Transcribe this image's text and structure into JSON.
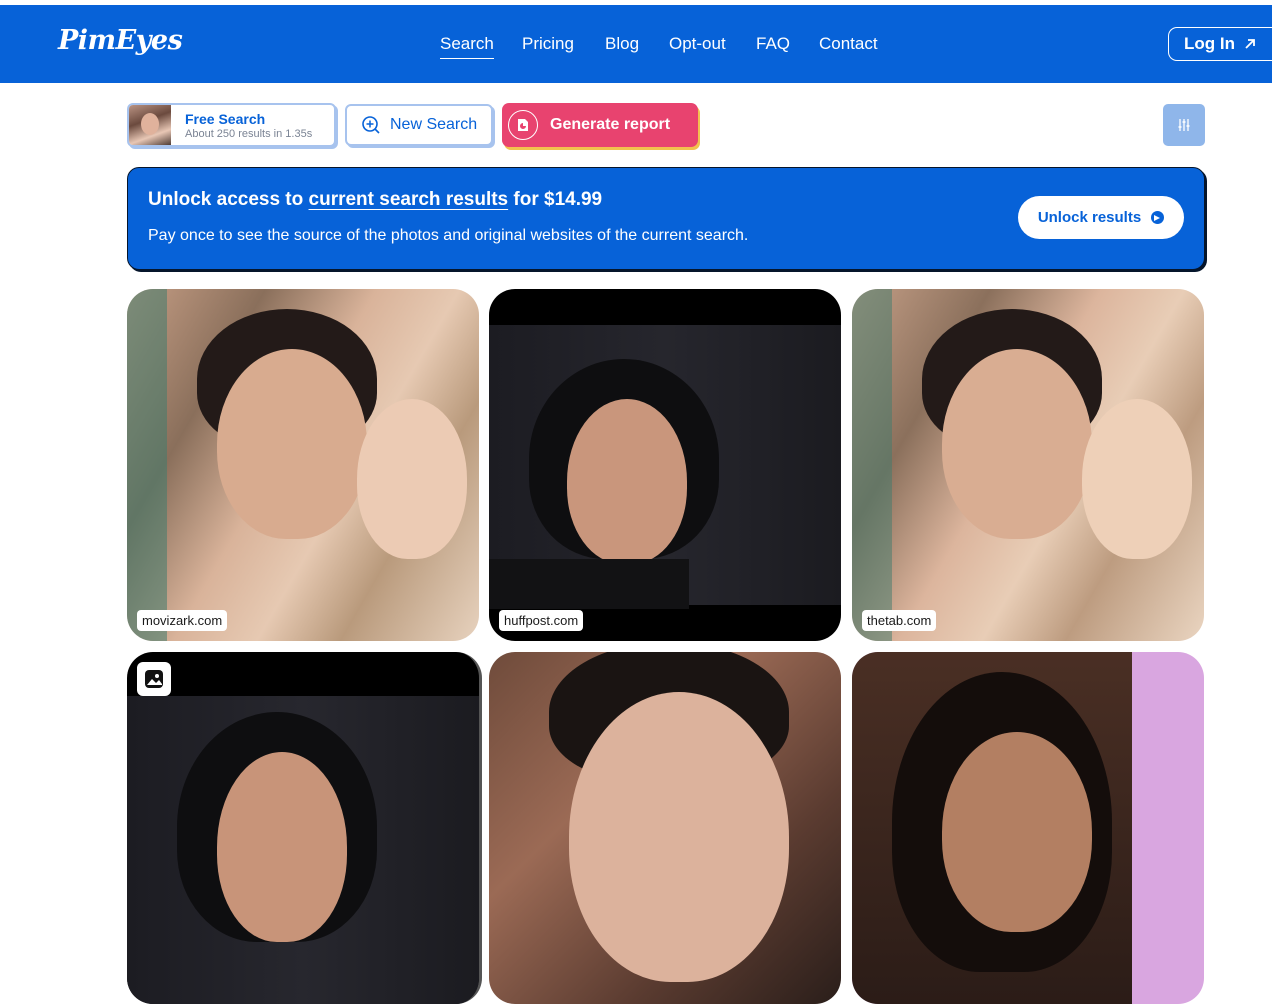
{
  "nav": {
    "logo": "PimEyes",
    "links": [
      "Search",
      "Pricing",
      "Blog",
      "Opt-out",
      "FAQ",
      "Contact"
    ],
    "login_label": "Log In"
  },
  "toolbar": {
    "free_title": "Free Search",
    "free_sub": "About 250 results in 1.35s",
    "new_search": "New Search",
    "generate_report": "Generate report"
  },
  "banner": {
    "title_prefix": "Unlock access to ",
    "title_link": "current search results",
    "title_mid": " for  ",
    "price": "$14.99",
    "description": "Pay once to see the source of the photos and original websites of the current search.",
    "unlock_label": "Unlock results"
  },
  "results": [
    {
      "source": "movizark.com"
    },
    {
      "source": "huffpost.com"
    },
    {
      "source": "thetab.com"
    },
    {
      "source": ""
    },
    {
      "source": ""
    },
    {
      "source": ""
    }
  ],
  "colors": {
    "brand_blue": "#0762d8",
    "report_pink": "#e8436f",
    "report_shadow": "#f2c14e"
  }
}
